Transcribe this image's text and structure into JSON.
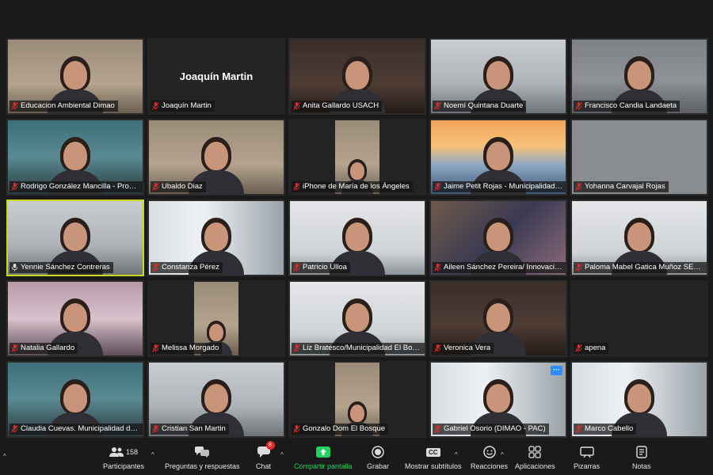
{
  "participants_grid": [
    {
      "name": "Educacion Ambiental Dimao",
      "muted": true,
      "scene": "bg-wall-warm",
      "content": "person"
    },
    {
      "name": "Joaquín Martin",
      "muted": true,
      "scene": "dark",
      "content": "name",
      "display_name": "Joaquín Martin"
    },
    {
      "name": "Anita Gallardo USACH",
      "muted": true,
      "scene": "bg-dark-room",
      "content": "person"
    },
    {
      "name": "Noemí Quintana Duarte",
      "muted": true,
      "scene": "bg-office",
      "content": "person"
    },
    {
      "name": "Francisco Candia Landaeta",
      "muted": true,
      "scene": "bg-wall-grey",
      "content": "person"
    },
    {
      "name": "Rodrigo González Mancilla - Progr...",
      "muted": true,
      "scene": "bg-teal",
      "content": "person"
    },
    {
      "name": "Ubaldo Diaz",
      "muted": true,
      "scene": "bg-wall-warm",
      "content": "person"
    },
    {
      "name": "iPhone de María de los Ángeles",
      "muted": true,
      "scene": "dark",
      "content": "inset"
    },
    {
      "name": "Jaime Petit Rojas - Municipalidad L...",
      "muted": true,
      "scene": "bg-bridge",
      "content": "person"
    },
    {
      "name": "Yohanna Carvajal Rojas",
      "muted": true,
      "scene": "bg-plain",
      "content": "none"
    },
    {
      "name": "Yennie Sánchez Contreras",
      "muted": false,
      "scene": "bg-office",
      "content": "person",
      "active": true
    },
    {
      "name": "Constanza Pérez",
      "muted": true,
      "scene": "bg-window",
      "content": "person"
    },
    {
      "name": "Patricio Ulloa",
      "muted": true,
      "scene": "bg-whiteboard",
      "content": "person"
    },
    {
      "name": "Aileen Sánchez Pereira/ Innovación ...",
      "muted": true,
      "scene": "bg-blurred",
      "content": "person"
    },
    {
      "name": "Paloma Mabel Gatica Muñoz SECP...",
      "muted": true,
      "scene": "bg-whiteboard",
      "content": "person"
    },
    {
      "name": "Natalia Gallardo",
      "muted": true,
      "scene": "bg-pink",
      "content": "person"
    },
    {
      "name": "Melissa Morgado",
      "muted": true,
      "scene": "dark",
      "content": "inset"
    },
    {
      "name": "Liz Bratesco/Municipalidad El Bosq...",
      "muted": true,
      "scene": "bg-whiteboard",
      "content": "person"
    },
    {
      "name": "Veronica Vera",
      "muted": true,
      "scene": "bg-dark-room",
      "content": "person"
    },
    {
      "name": "apena",
      "muted": true,
      "scene": "dark",
      "content": "none"
    },
    {
      "name": "Claudia Cuevas. Municipalidad de L...",
      "muted": true,
      "scene": "bg-teal",
      "content": "person"
    },
    {
      "name": "Cristian San Martin",
      "muted": true,
      "scene": "bg-office",
      "content": "person"
    },
    {
      "name": "Gonzalo Dom El Bosque",
      "muted": true,
      "scene": "dark",
      "content": "inset"
    },
    {
      "name": "Gabriel Osorio (DIMAO - PAC)",
      "muted": true,
      "scene": "bg-window",
      "content": "person",
      "more": true
    },
    {
      "name": "Marco Cabello",
      "muted": true,
      "scene": "bg-window",
      "content": "person"
    }
  ],
  "more_button": "···",
  "toolbar": {
    "participants": {
      "label": "Participantes",
      "count": "158",
      "icon": "participants-icon"
    },
    "qa": {
      "label": "Preguntas y respuestas",
      "icon": "qa-icon"
    },
    "chat": {
      "label": "Chat",
      "badge": "8",
      "icon": "chat-icon"
    },
    "share": {
      "label": "Compartir pantalla",
      "icon": "share-screen-icon"
    },
    "record": {
      "label": "Grabar",
      "icon": "record-icon"
    },
    "captions": {
      "label": "Mostrar subtítulos",
      "glyph": "CC",
      "icon": "captions-icon"
    },
    "reactions": {
      "label": "Reacciones",
      "icon": "reactions-icon"
    },
    "apps": {
      "label": "Aplicaciones",
      "icon": "apps-icon"
    },
    "whiteboards": {
      "label": "Pizarras",
      "icon": "whiteboard-icon"
    },
    "notes": {
      "label": "Notas",
      "icon": "notes-icon"
    }
  },
  "colors": {
    "muted_mic": "#e02828",
    "active_border": "#c9d91f",
    "share_green": "#23d160",
    "chat_badge": "#e02828"
  }
}
